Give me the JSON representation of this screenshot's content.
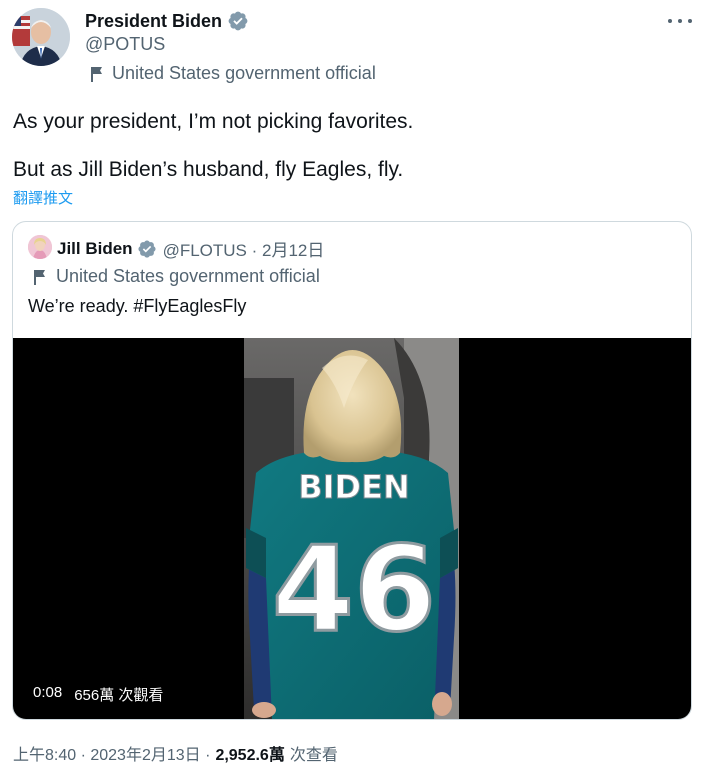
{
  "author": {
    "display_name": "President Biden",
    "handle": "@POTUS",
    "label": "United States government official"
  },
  "tweet": {
    "line1": "As your president, I’m not picking favorites.",
    "line2": "But as Jill Biden’s husband, fly Eagles, fly.",
    "translate": "翻譯推文"
  },
  "quoted": {
    "display_name": "Jill Biden",
    "meta": "@FLOTUS · 2月12日",
    "label": "United States government official",
    "text": "We’re ready. #FlyEaglesFly",
    "video": {
      "duration": "0:08",
      "views": "656萬 次觀看",
      "jersey_name": "BIDEN",
      "jersey_number": "46"
    }
  },
  "footer": {
    "time": "上午8:40 · 2023年2月13日 ·",
    "views_count": "2,952.6萬",
    "views_label": "次查看"
  },
  "colors": {
    "verified": "#829aab",
    "link": "#1d9bf0",
    "eagles_green": "#0c6b73"
  }
}
